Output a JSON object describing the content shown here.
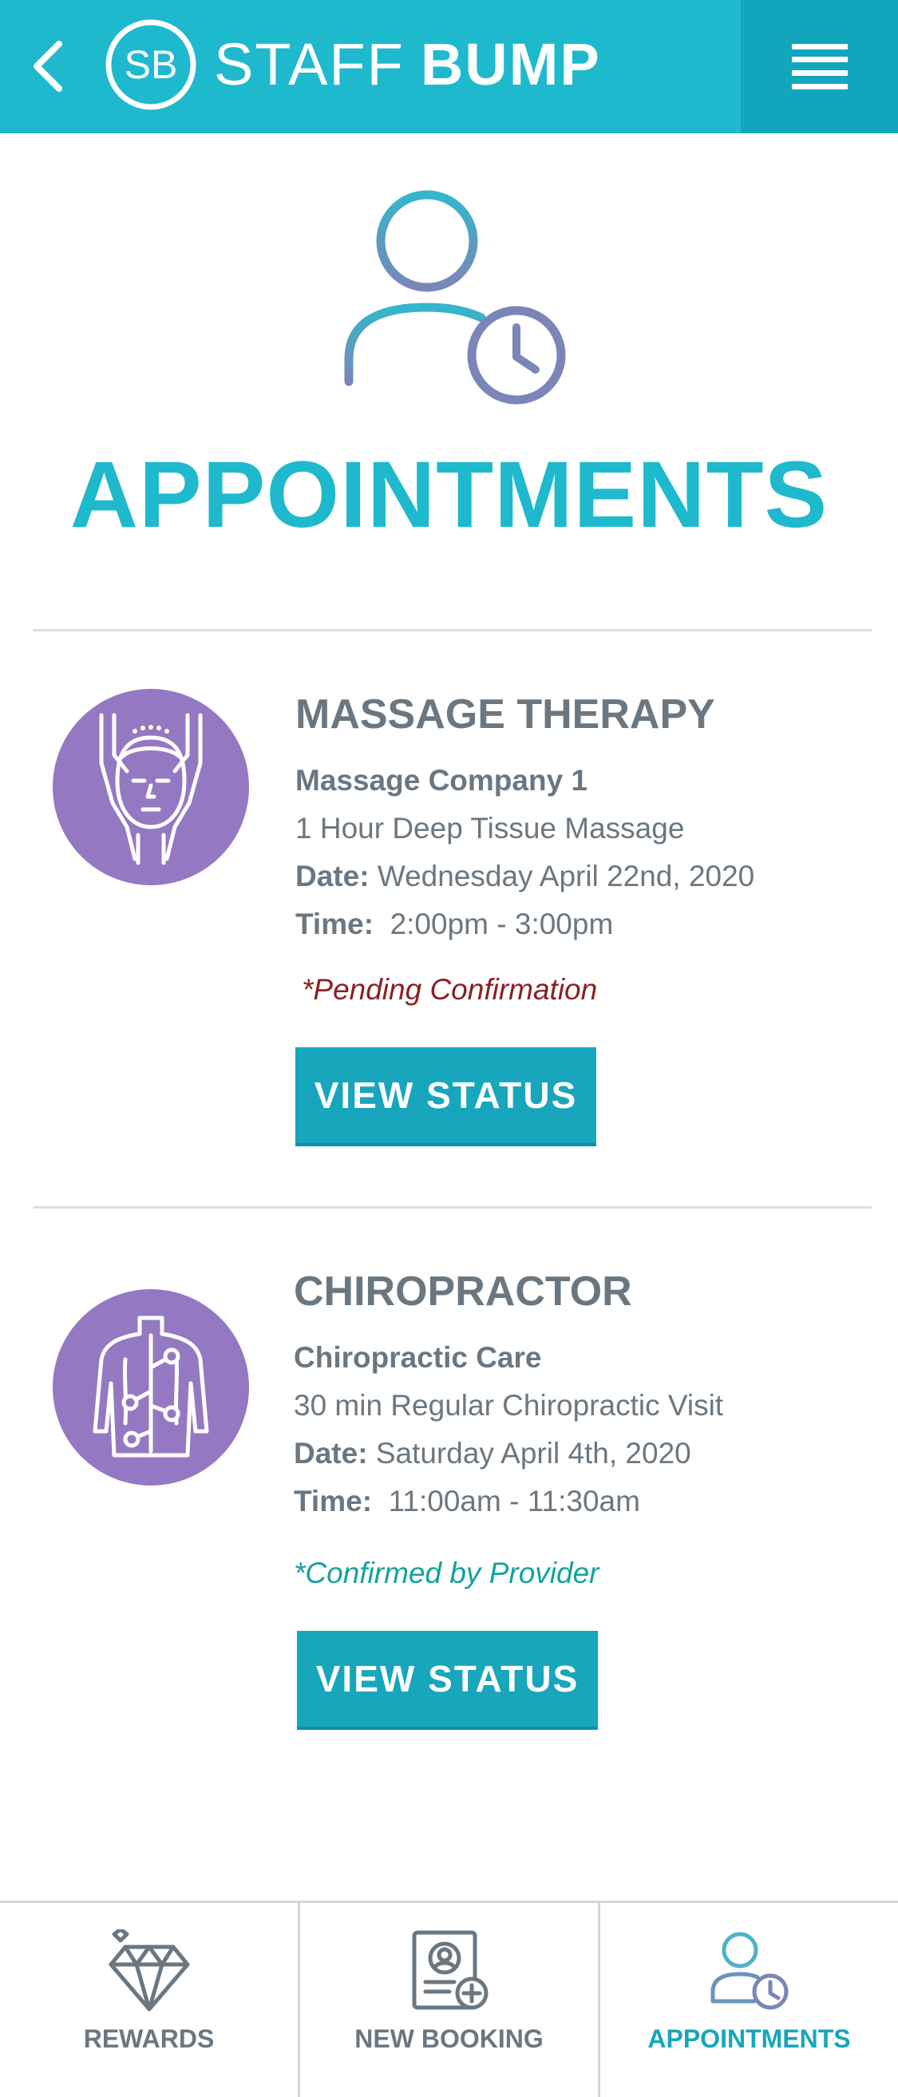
{
  "header": {
    "logo_text": "SB",
    "brand_light": "STAFF",
    "brand_bold": "BUMP",
    "back_icon": "chevron-left-icon",
    "menu_icon": "hamburger-menu-icon"
  },
  "page": {
    "title": "APPOINTMENTS",
    "icon": "user-clock-icon"
  },
  "appointments": [
    {
      "title": "MASSAGE THERAPY",
      "company": "Massage Company 1",
      "service": "1 Hour Deep Tissue Massage",
      "date_label": "Date:",
      "date_value": "Wednesday April 22nd, 2020",
      "time_label": "Time:",
      "time_value": "2:00pm - 3:00pm",
      "status": "*Pending Confirmation",
      "button_label": "VIEW STATUS",
      "icon": "massage-face-icon"
    },
    {
      "title": "CHIROPRACTOR",
      "company": "Chiropractic Care",
      "service": "30 min Regular Chiropractic Visit",
      "date_label": "Date:",
      "date_value": "Saturday April 4th, 2020",
      "time_label": "Time:",
      "time_value": "11:00am - 11:30am",
      "status": "*Confirmed by Provider",
      "button_label": "VIEW STATUS",
      "icon": "spine-back-icon"
    }
  ],
  "bottom_nav": {
    "items": [
      {
        "label": "REWARDS",
        "icon": "diamond-icon",
        "active": false
      },
      {
        "label": "NEW BOOKING",
        "icon": "booking-add-icon",
        "active": false
      },
      {
        "label": "APPOINTMENTS",
        "icon": "user-clock-icon",
        "active": true
      }
    ]
  },
  "colors": {
    "primary": "#1fb9cd",
    "button": "#17a6bc",
    "avatar": "#9479c2",
    "pending": "#8d1f22",
    "confirmed": "#14a39a",
    "text": "#6b7780"
  }
}
